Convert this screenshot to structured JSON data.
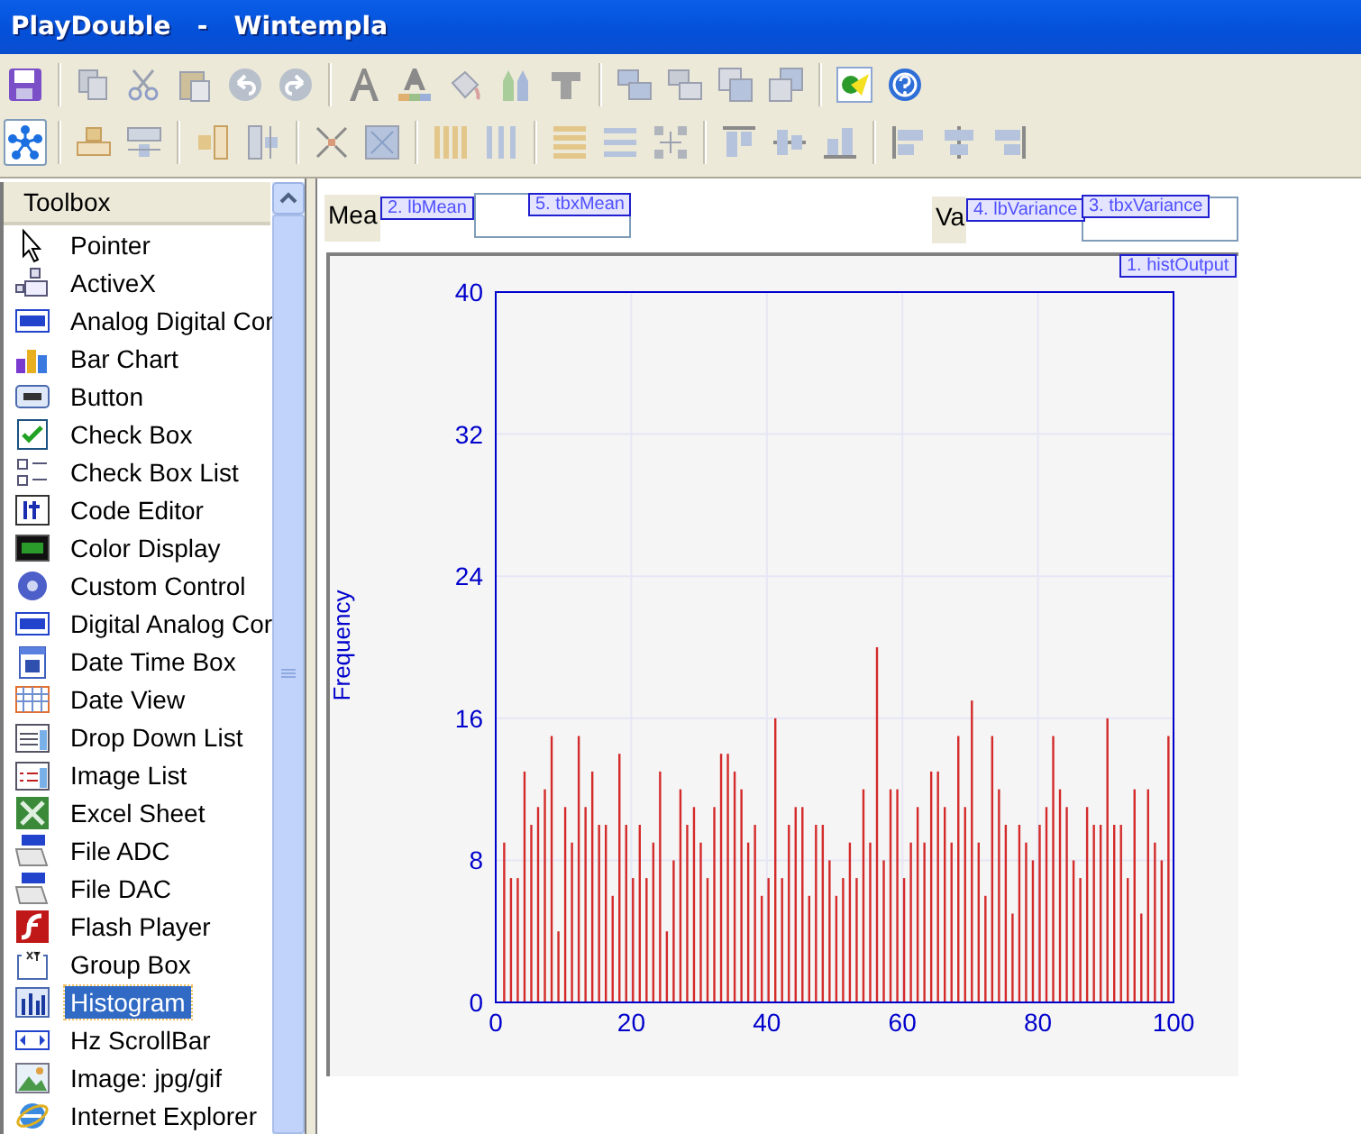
{
  "window": {
    "title": "PlayDouble   -   Wintempla"
  },
  "toolbox": {
    "title": "Toolbox",
    "items": [
      {
        "label": "Pointer",
        "selected": false
      },
      {
        "label": "ActiveX",
        "selected": false
      },
      {
        "label": "Analog Digital Cor",
        "selected": false
      },
      {
        "label": "Bar Chart",
        "selected": false
      },
      {
        "label": "Button",
        "selected": false
      },
      {
        "label": "Check Box",
        "selected": false
      },
      {
        "label": "Check Box List",
        "selected": false
      },
      {
        "label": "Code Editor",
        "selected": false
      },
      {
        "label": "Color Display",
        "selected": false
      },
      {
        "label": "Custom Control",
        "selected": false
      },
      {
        "label": "Digital Analog Cor",
        "selected": false
      },
      {
        "label": "Date Time Box",
        "selected": false
      },
      {
        "label": "Date View",
        "selected": false
      },
      {
        "label": "Drop Down List",
        "selected": false
      },
      {
        "label": "Image List",
        "selected": false
      },
      {
        "label": "Excel Sheet",
        "selected": false
      },
      {
        "label": "File ADC",
        "selected": false
      },
      {
        "label": "File DAC",
        "selected": false
      },
      {
        "label": "Flash Player",
        "selected": false
      },
      {
        "label": "Group Box",
        "selected": false
      },
      {
        "label": "Histogram",
        "selected": true
      },
      {
        "label": "Hz ScrollBar",
        "selected": false
      },
      {
        "label": "Image: jpg/gif",
        "selected": false
      },
      {
        "label": "Internet Explorer",
        "selected": false
      }
    ]
  },
  "form": {
    "mean_label": "Mea",
    "variance_label": "Va",
    "tags": [
      "2. lbMean",
      "5. tbxMean",
      "4. lbVariance",
      "3. tbxVariance",
      "1. histOutput"
    ],
    "histogram": {
      "chart_data": {
        "type": "bar",
        "ylabel": "Frequency",
        "x": [
          1,
          2,
          3,
          4,
          5,
          6,
          7,
          8,
          9,
          10,
          11,
          12,
          13,
          14,
          15,
          16,
          17,
          18,
          19,
          20,
          21,
          22,
          23,
          24,
          25,
          26,
          27,
          28,
          29,
          30,
          31,
          32,
          33,
          34,
          35,
          36,
          37,
          38,
          39,
          40,
          41,
          42,
          43,
          44,
          45,
          46,
          47,
          48,
          49,
          50,
          51,
          52,
          53,
          54,
          55,
          56,
          57,
          58,
          59,
          60,
          61,
          62,
          63,
          64,
          65,
          66,
          67,
          68,
          69,
          70,
          71,
          72,
          73,
          74,
          75,
          76,
          77,
          78,
          79,
          80,
          81,
          82,
          83,
          84,
          85,
          86,
          87,
          88,
          89,
          90,
          91,
          92,
          93,
          94,
          95,
          96,
          97,
          98,
          99
        ],
        "values": [
          9,
          7,
          7,
          13,
          10,
          11,
          12,
          15,
          4,
          11,
          9,
          15,
          11,
          13,
          10,
          10,
          6,
          14,
          10,
          7,
          10,
          7,
          9,
          13,
          4,
          8,
          12,
          10,
          11,
          9,
          7,
          11,
          14,
          14,
          13,
          12,
          9,
          10,
          6,
          7,
          16,
          7,
          10,
          11,
          11,
          6,
          10,
          10,
          8,
          6,
          7,
          9,
          7,
          12,
          9,
          20,
          8,
          12,
          12,
          7,
          9,
          11,
          9,
          13,
          13,
          11,
          9,
          15,
          11,
          17,
          9,
          6,
          15,
          12,
          10,
          5,
          10,
          9,
          8,
          10,
          11,
          15,
          12,
          11,
          8,
          7,
          11,
          10,
          10,
          16,
          10,
          10,
          7,
          12,
          5,
          12,
          9,
          8,
          15
        ],
        "xlim": [
          0,
          100
        ],
        "ylim": [
          0,
          40
        ],
        "grid": true,
        "xticks": [
          0,
          20,
          40,
          60,
          80,
          100
        ],
        "yticks": [
          0,
          8,
          16,
          24,
          32,
          40
        ]
      }
    }
  }
}
